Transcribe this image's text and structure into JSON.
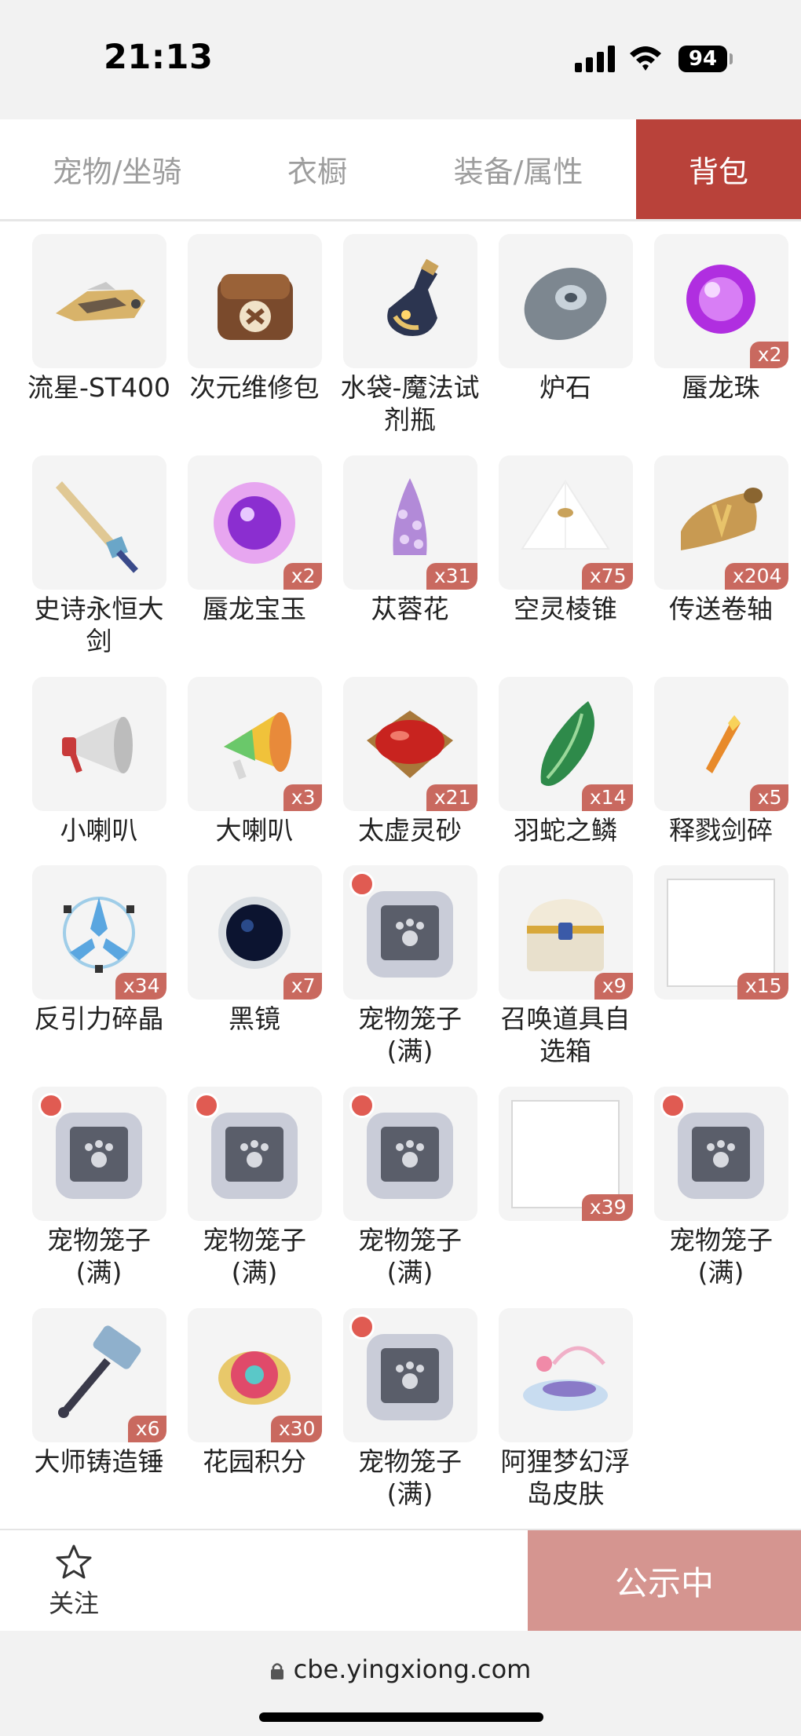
{
  "status_bar": {
    "time": "21:13",
    "battery": "94"
  },
  "tabs": [
    {
      "label": "宠物/坐骑",
      "active": false
    },
    {
      "label": "衣橱",
      "active": false
    },
    {
      "label": "装备/属性",
      "active": false
    },
    {
      "label": "背包",
      "active": true
    }
  ],
  "items": [
    {
      "name": "流星-ST400",
      "count": "",
      "icon": "hover-bike-icon"
    },
    {
      "name": "次元维修包",
      "count": "",
      "icon": "repair-bag-icon"
    },
    {
      "name": "水袋-魔法试剂瓶",
      "count": "",
      "icon": "potion-bottle-icon"
    },
    {
      "name": "炉石",
      "count": "",
      "icon": "hearthstone-icon"
    },
    {
      "name": "蜃龙珠",
      "count": "x2",
      "icon": "purple-orb-icon"
    },
    {
      "name": "史诗永恒大剑",
      "count": "",
      "icon": "greatsword-icon"
    },
    {
      "name": "蜃龙宝玉",
      "count": "x2",
      "icon": "dragon-jade-icon"
    },
    {
      "name": "苁蓉花",
      "count": "x31",
      "icon": "cistanche-flower-icon"
    },
    {
      "name": "空灵棱锥",
      "count": "x75",
      "icon": "pyramid-icon"
    },
    {
      "name": "传送卷轴",
      "count": "x204",
      "icon": "teleport-scroll-icon"
    },
    {
      "name": "小喇叭",
      "count": "",
      "icon": "small-megaphone-icon"
    },
    {
      "name": "大喇叭",
      "count": "x3",
      "icon": "big-megaphone-icon"
    },
    {
      "name": "太虚灵砂",
      "count": "x21",
      "icon": "red-gem-icon"
    },
    {
      "name": "羽蛇之鳞",
      "count": "x14",
      "icon": "green-scale-icon"
    },
    {
      "name": "释戮剑碎",
      "count": "x5",
      "icon": "sword-shard-icon"
    },
    {
      "name": "反引力碎晶",
      "count": "x34",
      "icon": "crystal-shard-icon"
    },
    {
      "name": "黑镜",
      "count": "x7",
      "icon": "black-mirror-icon"
    },
    {
      "name": "宠物笼子(满)",
      "count": "",
      "icon": "pet-cage-icon"
    },
    {
      "name": "召唤道具自选箱",
      "count": "x9",
      "icon": "treasure-chest-icon"
    },
    {
      "name": "",
      "count": "x15",
      "icon": "blank-item-icon"
    },
    {
      "name": "宠物笼子(满)",
      "count": "",
      "icon": "pet-cage-icon"
    },
    {
      "name": "宠物笼子(满)",
      "count": "",
      "icon": "pet-cage-icon"
    },
    {
      "name": "宠物笼子(满)",
      "count": "",
      "icon": "pet-cage-icon"
    },
    {
      "name": "",
      "count": "x39",
      "icon": "blank-item-icon"
    },
    {
      "name": "宠物笼子(满)",
      "count": "",
      "icon": "pet-cage-icon"
    },
    {
      "name": "大师铸造锤",
      "count": "x6",
      "icon": "forge-hammer-icon"
    },
    {
      "name": "花园积分",
      "count": "x30",
      "icon": "garden-points-icon"
    },
    {
      "name": "宠物笼子(满)",
      "count": "",
      "icon": "pet-cage-icon"
    },
    {
      "name": "阿狸梦幻浮岛皮肤",
      "count": "",
      "icon": "floating-island-skin-icon"
    }
  ],
  "footer": {
    "follow_label": "关注",
    "status_button": "公示中"
  },
  "browser": {
    "url": "cbe.yingxiong.com"
  },
  "colors": {
    "accent": "#b9423a",
    "badge": "#c9695f",
    "status_button": "#d59590"
  }
}
